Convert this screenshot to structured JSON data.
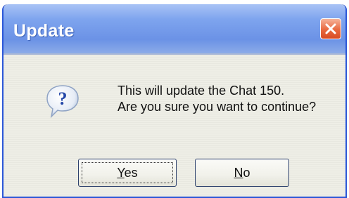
{
  "dialog": {
    "title": "Update",
    "close_icon": "close-icon",
    "question_icon": "question-icon",
    "message_line1": "This will update the Chat 150.",
    "message_line2": "Are you sure you want to continue?",
    "buttons": {
      "yes": {
        "mnemonic": "Y",
        "rest": "es"
      },
      "no": {
        "mnemonic": "N",
        "rest": "o"
      }
    },
    "colors": {
      "titlebar": "#7ea4ee",
      "close_button": "#e8683f",
      "body": "#eeeee6"
    }
  }
}
